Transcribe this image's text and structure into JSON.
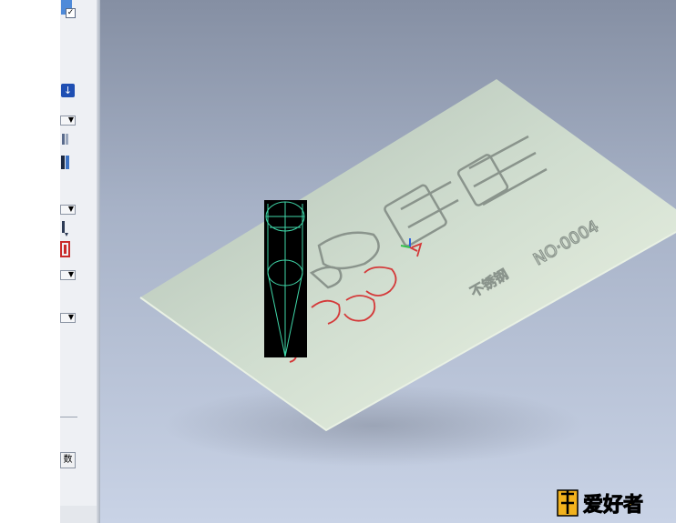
{
  "left_panel": {
    "checkbox_mark": "✓",
    "down_arrow_glyph": "↓",
    "combo_arrow": "▼",
    "button_label": "数"
  },
  "viewport": {
    "engraved_text": "NO·0004",
    "engraved_small": "不锈钢"
  },
  "watermark": {
    "logo_text": "爱好者"
  },
  "colors": {
    "plate": "#d9e6d3",
    "toolpath": "#d43a3a",
    "tool_wire": "#3fd6a8",
    "background_top": "#858fa3",
    "background_bottom": "#c9d3e6"
  }
}
